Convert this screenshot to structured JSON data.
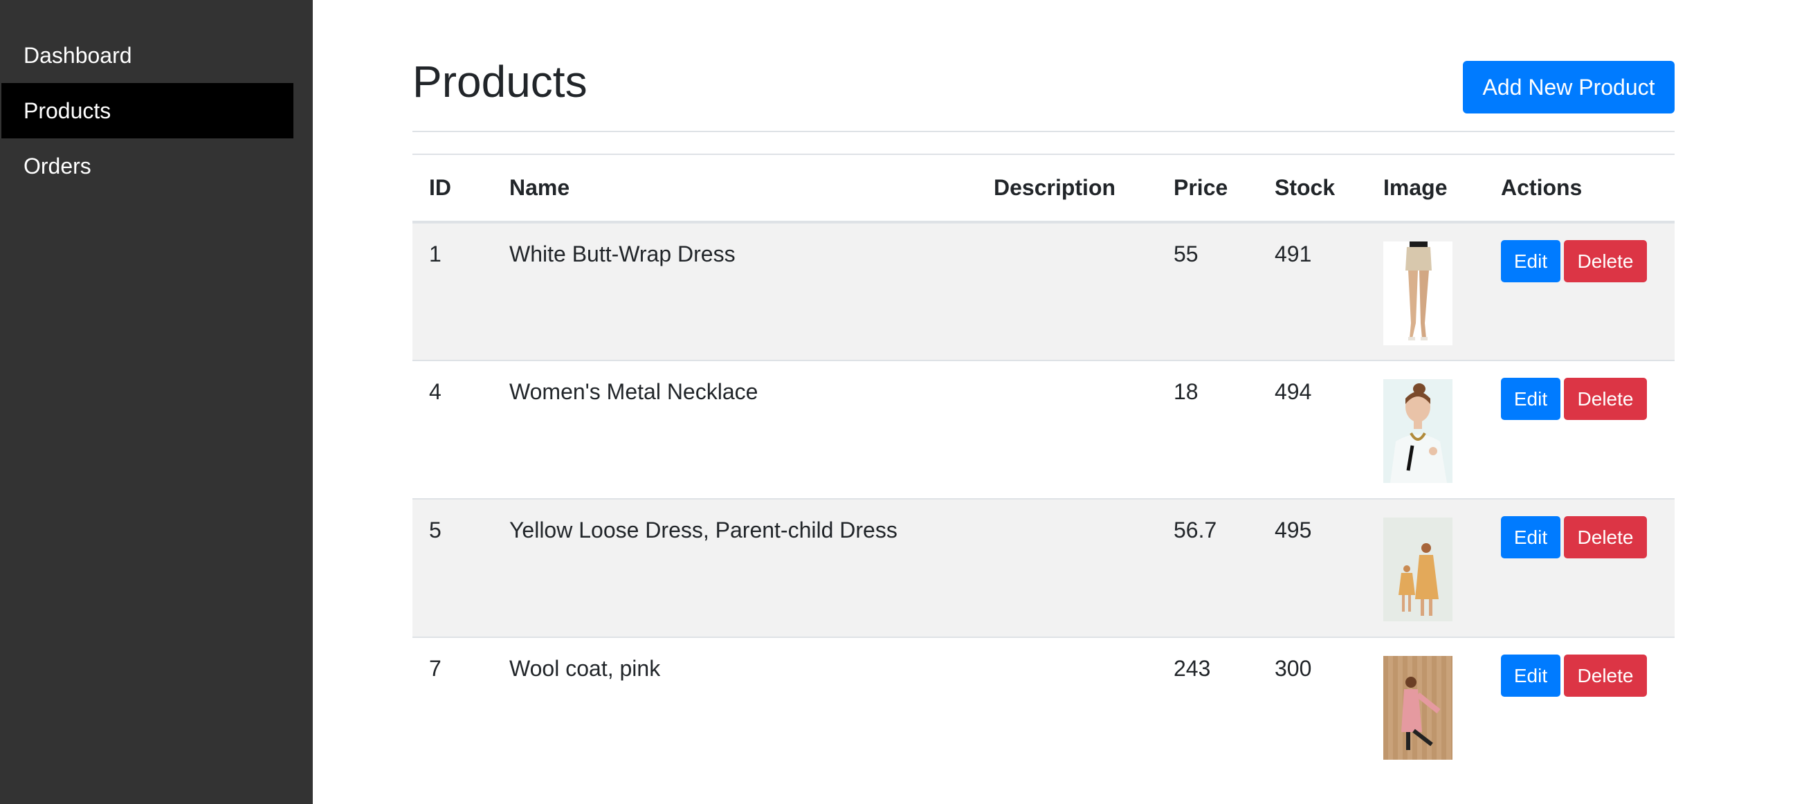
{
  "sidebar": {
    "items": [
      {
        "label": "Dashboard",
        "active": false
      },
      {
        "label": "Products",
        "active": true
      },
      {
        "label": "Orders",
        "active": false
      }
    ]
  },
  "header": {
    "title": "Products",
    "add_button_label": "Add New Product"
  },
  "table": {
    "columns": [
      "ID",
      "Name",
      "Description",
      "Price",
      "Stock",
      "Image",
      "Actions"
    ],
    "rows": [
      {
        "id": "1",
        "name": "White Butt-Wrap Dress",
        "description": "",
        "price": "55",
        "stock": "491",
        "image": "dress-legs-photo",
        "edit_label": "Edit",
        "delete_label": "Delete"
      },
      {
        "id": "4",
        "name": "Women's Metal Necklace",
        "description": "",
        "price": "18",
        "stock": "494",
        "image": "woman-necklace-photo",
        "edit_label": "Edit",
        "delete_label": "Delete"
      },
      {
        "id": "5",
        "name": "Yellow Loose Dress, Parent-child Dress",
        "description": "",
        "price": "56.7",
        "stock": "495",
        "image": "parent-child-dress-photo",
        "edit_label": "Edit",
        "delete_label": "Delete"
      },
      {
        "id": "7",
        "name": "Wool coat, pink",
        "description": "",
        "price": "243",
        "stock": "300",
        "image": "pink-coat-photo",
        "edit_label": "Edit",
        "delete_label": "Delete"
      }
    ]
  },
  "colors": {
    "sidebar_bg": "#333333",
    "sidebar_active_bg": "#000000",
    "primary": "#007bff",
    "danger": "#dc3545",
    "stripe": "#f2f2f2"
  }
}
